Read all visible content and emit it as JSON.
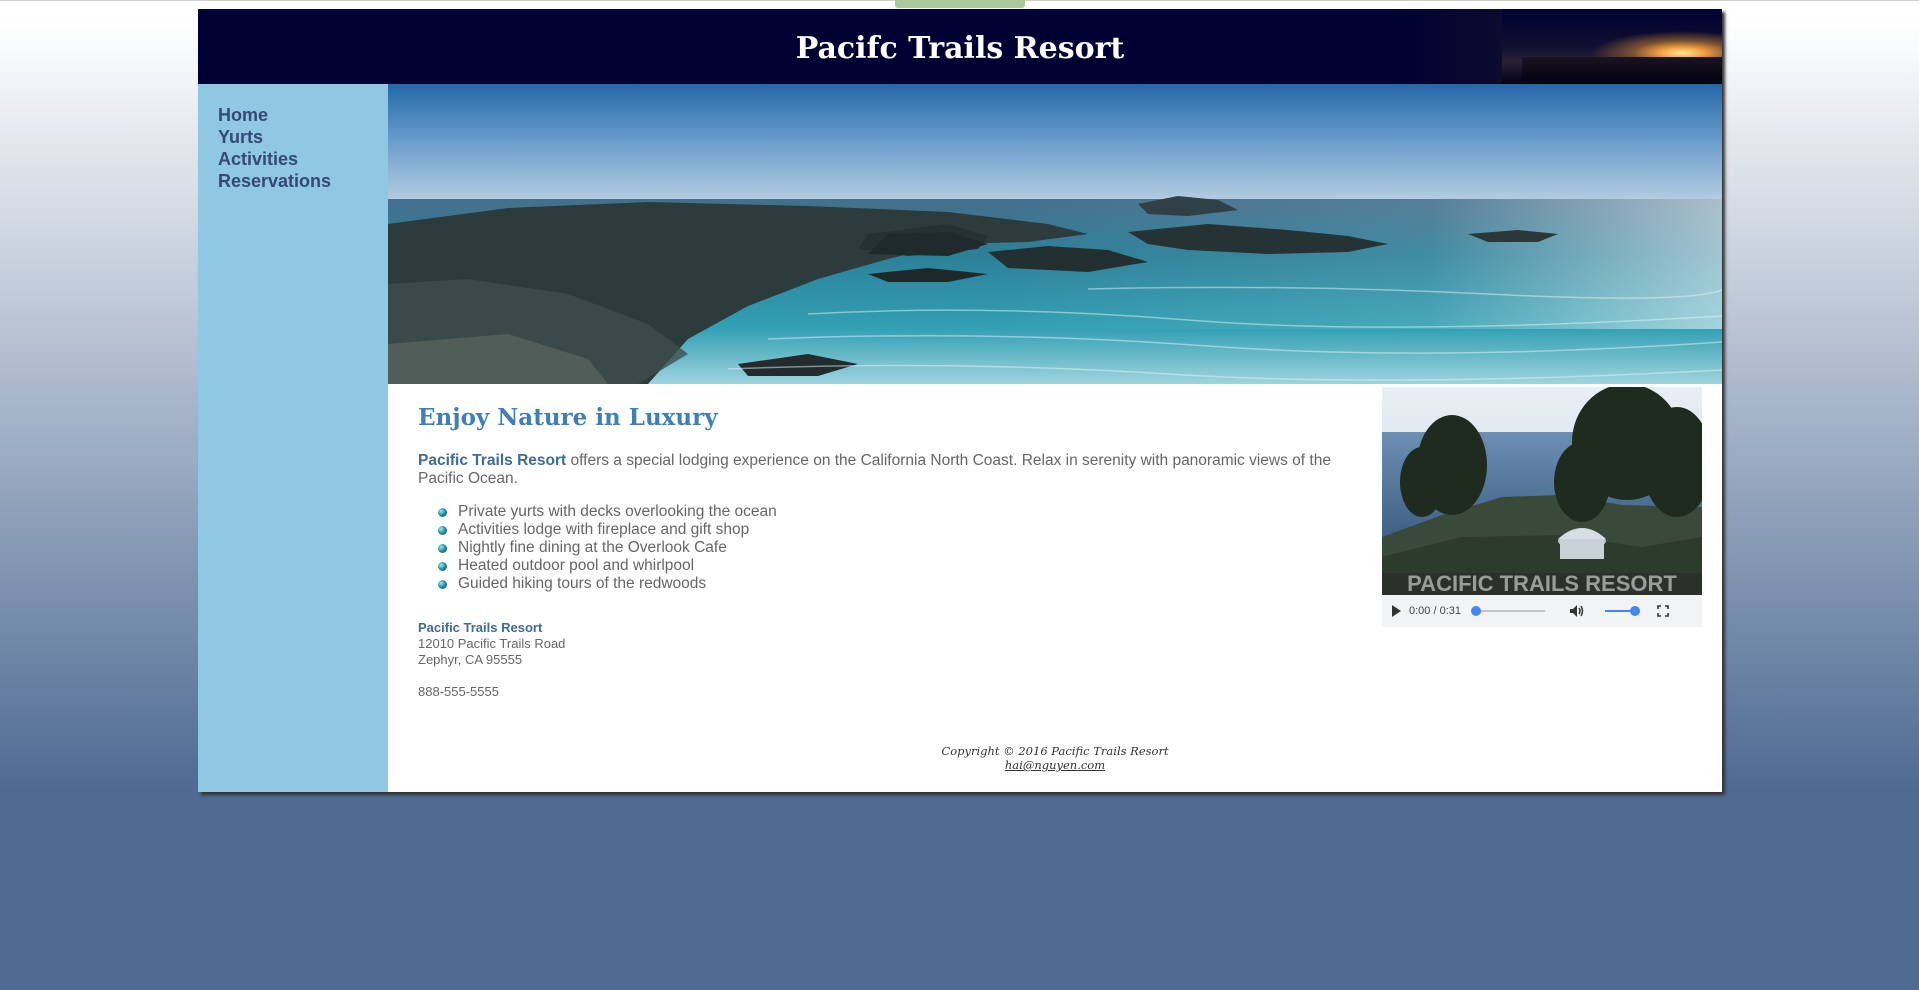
{
  "header": {
    "title": "Pacifc Trails Resort"
  },
  "nav": {
    "items": [
      "Home",
      "Yurts",
      "Activities",
      "Reservations"
    ]
  },
  "main": {
    "heading": "Enjoy Nature in Luxury",
    "intro_strong": "Pacific Trails Resort",
    "intro_text": " offers a special lodging experience on the California North Coast. Relax in serenity with panoramic views of the Pacific Ocean.",
    "features": [
      "Private yurts with decks overlooking the ocean",
      "Activities lodge with fireplace and gift shop",
      "Nightly fine dining at the Overlook Cafe",
      "Heated outdoor pool and whirlpool",
      "Guided hiking tours of the redwoods"
    ],
    "address": {
      "name": "Pacific Trails Resort",
      "street": "12010 Pacific Trails Road",
      "city": "Zephyr, CA 95555"
    },
    "phone": "888-555-5555"
  },
  "video": {
    "time": "0:00 / 0:31",
    "overlay_text": "PACIFIC TRAILS RESORT",
    "progress": 0,
    "volume": 1
  },
  "footer": {
    "copyright": "Copyright © 2016 Pacific Trails Resort",
    "email": "hai@nguyen.com"
  },
  "colors": {
    "header_bg": "#000033",
    "nav_bg": "#90c7e3",
    "nav_link": "#344a76",
    "heading": "#3f7fb3",
    "page_bg": "#4f6b93"
  }
}
